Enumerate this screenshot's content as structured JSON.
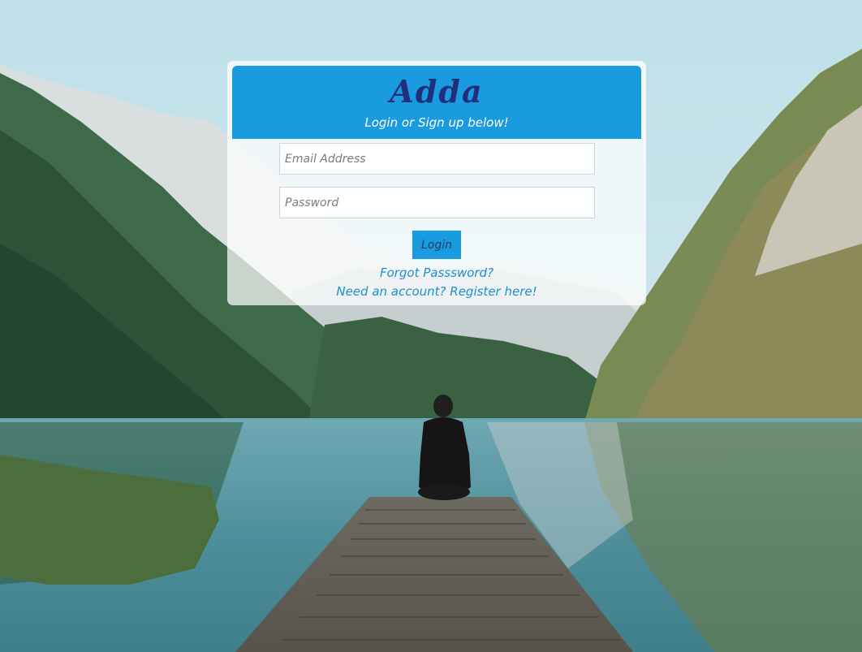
{
  "brand": {
    "name": "Adda",
    "tagline": "Login or Sign up below!"
  },
  "form": {
    "email_placeholder": "Email Address",
    "password_placeholder": "Password",
    "email_value": "",
    "password_value": "",
    "login_label": "Login",
    "forgot_label": "Forgot Passsword?",
    "register_label": "Need an account? Register here!"
  },
  "colors": {
    "header_blue": "#1a9be0",
    "brand_text": "#1f2f7a",
    "link_blue": "#1a8fcf"
  }
}
